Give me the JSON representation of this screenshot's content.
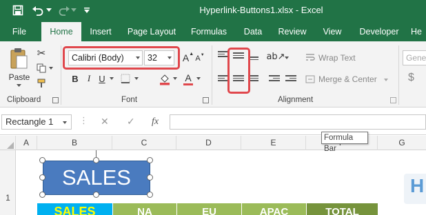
{
  "window": {
    "title": "Hyperlink-Buttons1.xlsx  -  Excel"
  },
  "qat": {
    "save_icon": "save-icon",
    "undo_icon": "undo-icon",
    "redo_icon": "redo-icon",
    "customize_icon": "customize-qat-icon"
  },
  "tabs": [
    {
      "label": "File"
    },
    {
      "label": "Home"
    },
    {
      "label": "Insert"
    },
    {
      "label": "Page Layout"
    },
    {
      "label": "Formulas"
    },
    {
      "label": "Data"
    },
    {
      "label": "Review"
    },
    {
      "label": "View"
    },
    {
      "label": "Developer"
    },
    {
      "label": "He"
    }
  ],
  "ribbon": {
    "clipboard": {
      "paste_label": "Paste",
      "group_label": "Clipboard"
    },
    "font": {
      "font_name": "Calibri (Body)",
      "font_size": "32",
      "grow_label": "A",
      "shrink_label": "A",
      "bold_label": "B",
      "italic_label": "I",
      "underline_label": "U",
      "font_color_label": "A",
      "group_label": "Font"
    },
    "alignment": {
      "wrap_text_label": "Wrap Text",
      "merge_center_label": "Merge & Center",
      "group_label": "Alignment"
    },
    "number": {
      "format_label": "Gene",
      "currency_label": "$"
    }
  },
  "formula_bar": {
    "name_box": "Rectangle 1",
    "cancel_symbol": "✕",
    "enter_symbol": "✓",
    "fx_symbol": "fx",
    "value": "",
    "tooltip": "Formula Bar"
  },
  "grid": {
    "columns": [
      "A",
      "B",
      "C",
      "D",
      "E",
      "F",
      "G"
    ],
    "rows": [
      "1"
    ],
    "shape_text": "SALES",
    "header_row": [
      "SALES",
      "NA",
      "EU",
      "APAC",
      "TOTAL"
    ],
    "right_partial_text": "H"
  },
  "colors": {
    "excel_green": "#217346",
    "highlight_red": "#e0474c",
    "shape_blue": "#4a7bbf",
    "sales_cyan": "#00b0f0",
    "sales_text_yellow": "#ffff00",
    "region_green": "#9bbb59",
    "total_green": "#76933c"
  }
}
